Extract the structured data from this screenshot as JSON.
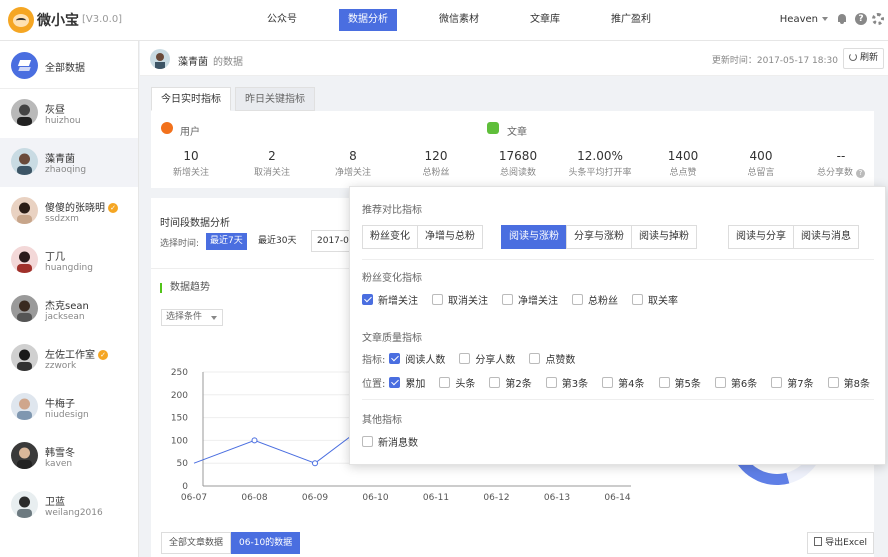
{
  "app": {
    "name": "微小宝",
    "version": "[V3.0.0]"
  },
  "nav": [
    "公众号",
    "数据分析",
    "微信素材",
    "文章库",
    "推广盈利"
  ],
  "nav_active": 1,
  "user": {
    "name": "Heaven"
  },
  "sidebar": {
    "all_label": "全部数据",
    "items": [
      {
        "name": "灰昼",
        "id": "huizhou",
        "verified": false
      },
      {
        "name": "藻青菌",
        "id": "zhaoqing",
        "verified": false
      },
      {
        "name": "傻傻的张晓明",
        "id": "ssdzxm",
        "verified": true
      },
      {
        "name": "丁几",
        "id": "huangding",
        "verified": false
      },
      {
        "name": "杰克sean",
        "id": "jacksean",
        "verified": false
      },
      {
        "name": "左佐工作室",
        "id": "zzwork",
        "verified": true
      },
      {
        "name": "牛梅子",
        "id": "niudesign",
        "verified": false
      },
      {
        "name": "韩雪冬",
        "id": "kaven",
        "verified": false
      },
      {
        "name": "卫蓝",
        "id": "weilang2016",
        "verified": false
      }
    ]
  },
  "header": {
    "account": "藻青菌",
    "suffix": "的数据",
    "update": "更新时间：2017-05-17 18:30",
    "refresh": "刷新"
  },
  "tabs": [
    "今日实时指标",
    "昨日关键指标"
  ],
  "stats": {
    "user_title": "用户",
    "article_title": "文章",
    "user": [
      {
        "value": "10",
        "label": "新增关注"
      },
      {
        "value": "2",
        "label": "取消关注"
      },
      {
        "value": "8",
        "label": "净增关注"
      },
      {
        "value": "120",
        "label": "总粉丝"
      }
    ],
    "article": [
      {
        "value": "17680",
        "label": "总阅读数"
      },
      {
        "value": "12.00%",
        "label": "头条平均打开率"
      },
      {
        "value": "1400",
        "label": "总点赞"
      },
      {
        "value": "400",
        "label": "总留言"
      },
      {
        "value": "--",
        "label": "总分享数"
      }
    ]
  },
  "timepanel": {
    "title": "时间段数据分析",
    "select_label": "选择时间:",
    "ranges": [
      "最近7天",
      "最近30天"
    ],
    "date_value": "2017-0",
    "trend_title": "数据趋势",
    "filter": "选择条件"
  },
  "chart_data": {
    "type": "line",
    "categories": [
      "06-07",
      "06-08",
      "06-09",
      "06-10",
      "06-11",
      "06-12",
      "06-13",
      "06-14"
    ],
    "yticks": [
      0,
      50,
      100,
      150,
      200,
      250
    ],
    "ylim": [
      0,
      250
    ],
    "series": [
      {
        "values": [
          50,
          100,
          50,
          150
        ]
      }
    ],
    "color": "#4a6ee0"
  },
  "bottom_tabs": [
    "全部文章数据",
    "06-10的数据"
  ],
  "export": "导出Excel",
  "popup": {
    "recommend_title": "推荐对比指标",
    "groups": [
      [
        "粉丝变化",
        "净增与总粉"
      ],
      [
        "阅读与涨粉",
        "分享与涨粉",
        "阅读与掉粉"
      ],
      [
        "阅读与分享",
        "阅读与消息"
      ]
    ],
    "active_seg": "阅读与涨粉",
    "fans_title": "粉丝变化指标",
    "fans": [
      {
        "label": "新增关注",
        "checked": true
      },
      {
        "label": "取消关注",
        "checked": false
      },
      {
        "label": "净增关注",
        "checked": false
      },
      {
        "label": "总粉丝",
        "checked": false
      },
      {
        "label": "取关率",
        "checked": false
      }
    ],
    "quality_title": "文章质量指标",
    "metric_label": "指标:",
    "metrics": [
      {
        "label": "阅读人数",
        "checked": true
      },
      {
        "label": "分享人数",
        "checked": false
      },
      {
        "label": "点赞数",
        "checked": false
      }
    ],
    "position_label": "位置:",
    "positions": [
      {
        "label": "累加",
        "checked": true
      },
      {
        "label": "头条",
        "checked": false
      },
      {
        "label": "第2条",
        "checked": false
      },
      {
        "label": "第3条",
        "checked": false
      },
      {
        "label": "第4条",
        "checked": false
      },
      {
        "label": "第5条",
        "checked": false
      },
      {
        "label": "第6条",
        "checked": false
      },
      {
        "label": "第7条",
        "checked": false
      },
      {
        "label": "第8条",
        "checked": false
      }
    ],
    "other_title": "其他指标",
    "others": [
      {
        "label": "新消息数",
        "checked": false
      }
    ]
  }
}
